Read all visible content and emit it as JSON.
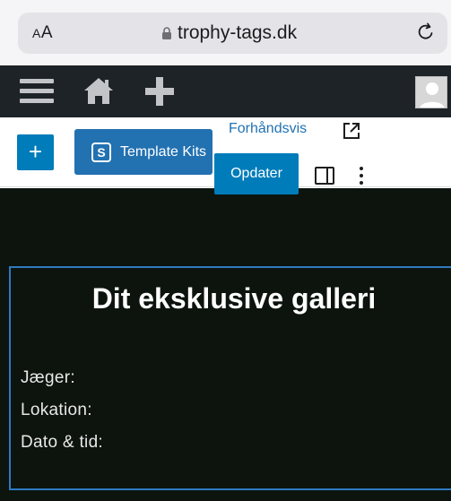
{
  "browser": {
    "aa_big": "A",
    "aa_small": "A",
    "url": "trophy-tags.dk"
  },
  "admin_bar": {
    "menu_icon": "menu-icon",
    "home_icon": "home-icon",
    "add_icon": "plus-icon",
    "avatar_icon": "avatar"
  },
  "toolbar": {
    "inserter_label": "+",
    "template_kits_label": "Template Kits",
    "template_kits_icon_letter": "S",
    "preview_label": "Forhåndsvis",
    "update_label": "Opdater"
  },
  "content": {
    "title": "Dit eksklusive galleri",
    "hunter_label": "Jæger:",
    "location_label": "Lokation:",
    "datetime_label": "Dato & tid:"
  },
  "colors": {
    "admin_bar_bg": "#1d2327",
    "accent_blue": "#007cba",
    "canvas_bg": "#0c140d",
    "selection_border": "#2f79c0"
  }
}
